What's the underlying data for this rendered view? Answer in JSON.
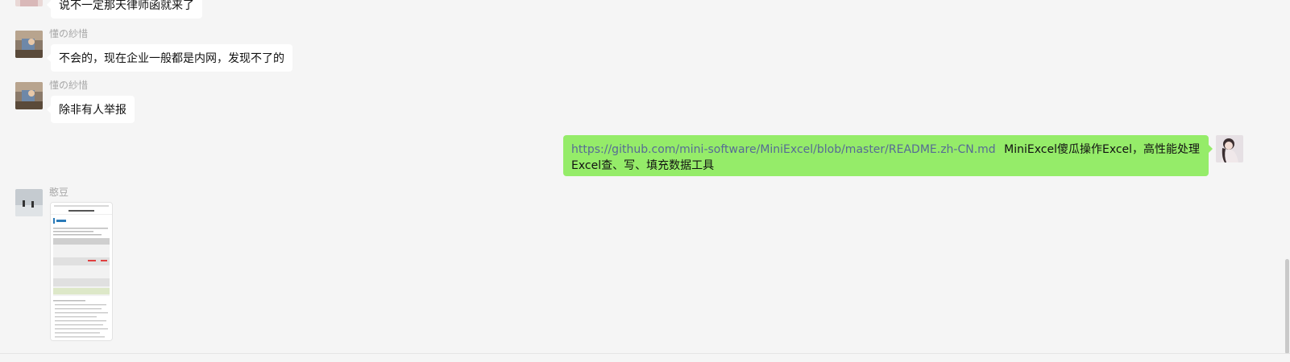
{
  "messages": [
    {
      "type": "text",
      "side": "left",
      "text": "说不一定那天律师函就来了"
    },
    {
      "type": "text",
      "side": "left",
      "sender": "懂の紗惜",
      "text": "不会的，现在企业一般都是内网，发现不了的"
    },
    {
      "type": "text",
      "side": "left",
      "sender": "懂の紗惜",
      "text": "除非有人举报"
    },
    {
      "type": "link",
      "side": "right",
      "link": "https://github.com/mini-software/MiniExcel/blob/master/README.zh-CN.md",
      "text": "MiniExcel傻瓜操作Excel，高性能处理Excel查、写、填充数据工具"
    },
    {
      "type": "image",
      "side": "left",
      "sender": "憨豆"
    }
  ],
  "colors": {
    "background": "#f5f5f5",
    "bubble_left": "#ffffff",
    "bubble_right": "#95ec69",
    "link": "#576b95",
    "sender_name": "#a8a8a8"
  },
  "icons": {
    "avatar_dongsha": "avatar-photo-person-at-desk",
    "avatar_self": "avatar-photo-girl",
    "avatar_handou": "avatar-photo-snow-scene"
  }
}
